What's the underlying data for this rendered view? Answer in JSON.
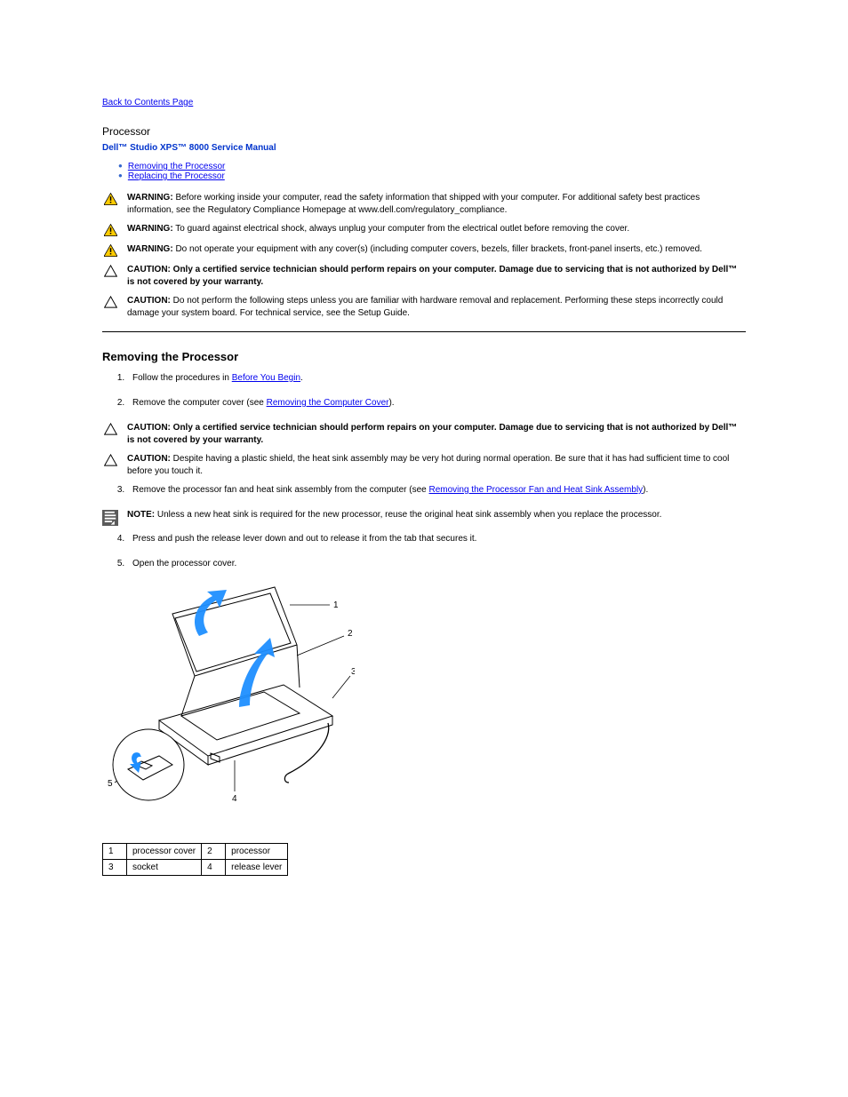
{
  "back_link": "Back to Contents Page",
  "page_title": "Processor",
  "manual_title": "Dell™ Studio XPS™ 8000 Service Manual",
  "toc": {
    "remove": "Removing the Processor",
    "replace": "Replacing the Processor"
  },
  "warnings": {
    "w1": {
      "label": "WARNING:",
      "text": "Before working inside your computer, read the safety information that shipped with your computer. For additional safety best practices information, see the Regulatory Compliance Homepage at www.dell.com/regulatory_compliance."
    },
    "w2": {
      "label": "WARNING:",
      "text": "To guard against electrical shock, always unplug your computer from the electrical outlet before removing the cover."
    },
    "w3": {
      "label": "WARNING:",
      "text": "Do not operate your equipment with any cover(s) (including computer covers, bezels, filler brackets, front-panel inserts, etc.) removed."
    },
    "c1": {
      "label": "CAUTION:",
      "text": "Only a certified service technician should perform repairs on your computer. Damage due to servicing that is not authorized by Dell™ is not covered by your warranty."
    },
    "c2": {
      "label": "CAUTION:",
      "text": "Do not perform the following steps unless you are familiar with hardware removal and replacement. Performing these steps incorrectly could damage your system board. For technical service, see the Setup Guide."
    }
  },
  "section1": {
    "heading": "Removing the Processor",
    "steps": {
      "s1a": "Follow the procedures in ",
      "s1link": "Before You Begin",
      "s1b": ".",
      "s2a": "Remove the computer cover (see ",
      "s2link": "Removing the Computer Cover",
      "s2b": ")."
    },
    "caution1": {
      "label": "CAUTION:",
      "text": "Only a certified service technician should perform repairs on your computer. Damage due to servicing that is not authorized by Dell™ is not covered by your warranty."
    },
    "caution2": {
      "label": "CAUTION:",
      "text": "Despite having a plastic shield, the heat sink assembly may be very hot during normal operation. Be sure that it has had sufficient time to cool before you touch it."
    },
    "step3": {
      "a": "Remove the processor fan and heat sink assembly from the computer (see ",
      "link": "Removing the Processor Fan and Heat Sink Assembly",
      "b": ")."
    },
    "note": {
      "label": "NOTE:",
      "text": "Unless a new heat sink is required for the new processor, reuse the original heat sink assembly when you replace the processor."
    },
    "step4": "Press and push the release lever down and out to release it from the tab that secures it.",
    "step5": "Open the processor cover."
  },
  "parts": {
    "r1c1": "1",
    "r1c2": "processor cover",
    "r1c3": "2",
    "r1c4": "processor",
    "r2c1": "3",
    "r2c2": "socket",
    "r2c3": "4",
    "r2c4": "release lever"
  }
}
